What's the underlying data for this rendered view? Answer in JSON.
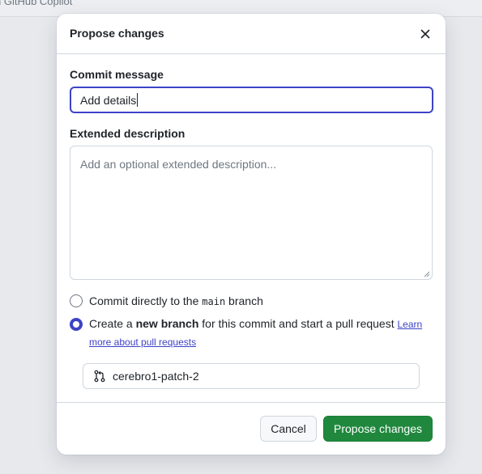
{
  "backdrop": {
    "text": "n GitHub Copilot"
  },
  "dialog": {
    "title": "Propose changes",
    "close_icon": "x-icon",
    "commit_message": {
      "label": "Commit message",
      "value": "Add details"
    },
    "extended_description": {
      "label": "Extended description",
      "placeholder": "Add an optional extended description..."
    },
    "options": {
      "direct": {
        "prefix": "Commit directly to the ",
        "branch": "main",
        "suffix": " branch",
        "checked": false
      },
      "new_branch": {
        "prefix": "Create a ",
        "bold": "new branch",
        "suffix": " for this commit and start a pull request ",
        "link": "Learn more about pull requests",
        "checked": true
      }
    },
    "branch_name": {
      "icon": "git-pull-request-icon",
      "value": "cerebro1-patch-2"
    },
    "footer": {
      "cancel_label": "Cancel",
      "submit_label": "Propose changes"
    }
  },
  "colors": {
    "accent": "#3d43c6",
    "primary_button": "#1f883d"
  }
}
